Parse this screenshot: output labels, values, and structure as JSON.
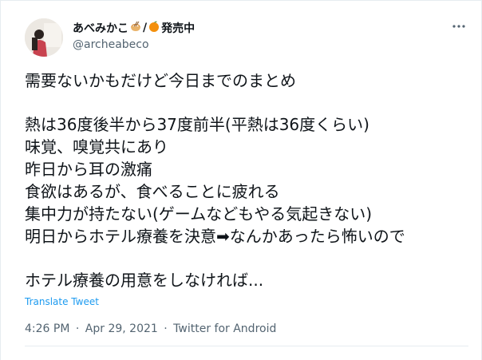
{
  "author": {
    "name": "あべみかこ",
    "name_suffix": "発売中",
    "name_separator": "/",
    "handle": "@archeabeco"
  },
  "tweet": {
    "lines": [
      "需要ないかもだけど今日までのまとめ",
      "",
      "熱は36度後半から37度前半(平熱は36度くらい)",
      "味覚、嗅覚共にあり",
      "昨日から耳の激痛",
      "食欲はあるが、食べることに疲れる",
      "集中力が持たない(ゲームなどもやる気起きない)",
      "明日からホテル療養を決意➡なんかあったら怖いので",
      "",
      "ホテル療養の用意をしなければ..."
    ]
  },
  "actions": {
    "translate_label": "Translate Tweet",
    "more_icon": "more-horizontal-icon"
  },
  "meta": {
    "time": "4:26 PM",
    "date": "Apr 29, 2021",
    "source": "Twitter for Android",
    "separator": "·"
  },
  "colors": {
    "text": "#0f1419",
    "secondary": "#536471",
    "link": "#1d9bf0"
  }
}
